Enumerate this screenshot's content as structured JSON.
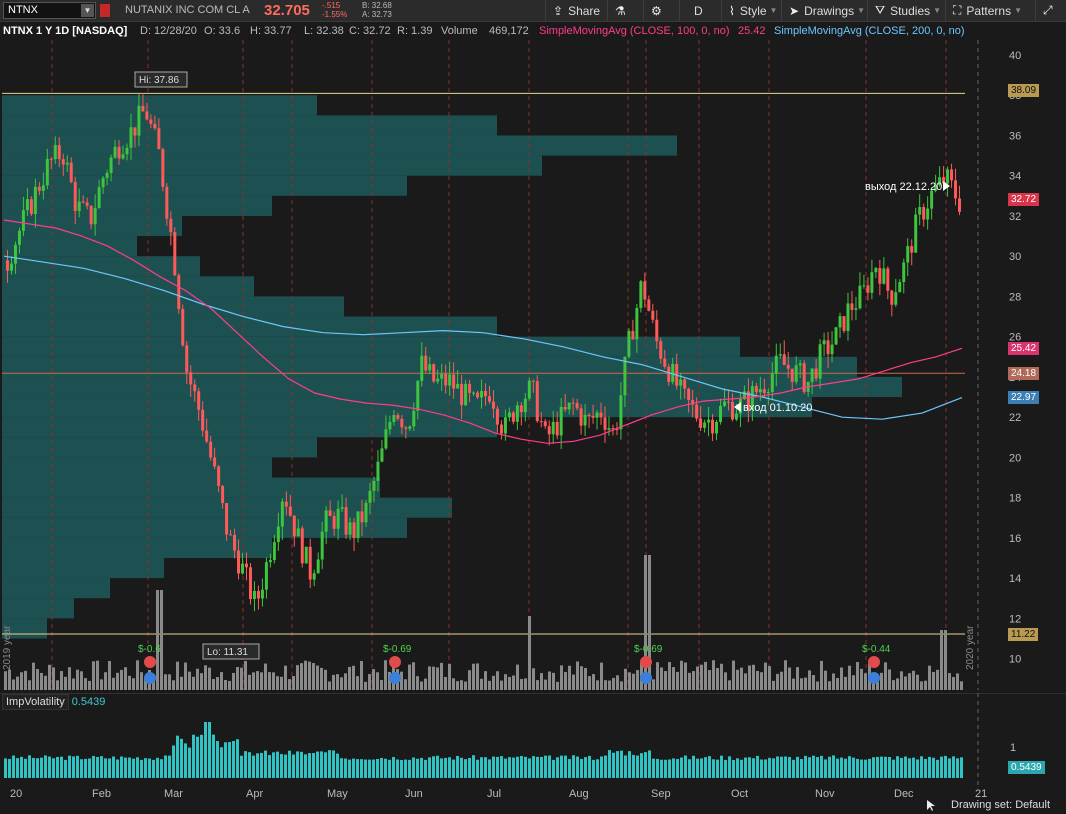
{
  "toolbar": {
    "symbol": "NTNX",
    "company": "NUTANIX INC COM CL A",
    "last": "32.705",
    "net_change": "-.515",
    "pct_change": "-1.55%",
    "bid": "B: 32.68",
    "ask": "A: 32.73",
    "share": "Share",
    "period": "D",
    "style": "Style",
    "drawings": "Drawings",
    "studies": "Studies",
    "patterns": "Patterns"
  },
  "header": {
    "title": "NTNX 1 Y 1D [NASDAQ]",
    "date": "D: 12/28/20",
    "open": "O: 33.6",
    "high": "H: 33.77",
    "low": "L: 32.38",
    "close": "C: 32.72",
    "range": "R: 1.39",
    "volume_label": "Volume",
    "volume": "469,172",
    "sma100": "SimpleMovingAvg (CLOSE, 100, 0, no)",
    "sma100_val": "25.42",
    "sma200": "SimpleMovingAvg (CLOSE, 200, 0, no)",
    "sma200_val": "22.97"
  },
  "annotations": {
    "hi": "Hi: 37.86",
    "lo": "Lo: 11.31",
    "entry": "вход 01.10.20",
    "exit": "выход 22.12.20",
    "earn1": "$-0.6",
    "earn2": "$-0.69",
    "earn3": "$-0.69",
    "earn4": "$-0.44",
    "year_2019": "2019 year",
    "year_2020": "2020 year"
  },
  "price_tags": {
    "hi_line": "38.09",
    "last": "32.72",
    "sma100": "25.42",
    "hline": "24.18",
    "sma200": "22.97",
    "lo_line": "11.22"
  },
  "iv": {
    "label": "ImpVolatility",
    "value": "0.5439",
    "axis_1": "1"
  },
  "y_axis_labels": [
    "40",
    "38",
    "36",
    "34",
    "32",
    "30",
    "28",
    "26",
    "24",
    "22",
    "20",
    "18",
    "16",
    "14",
    "12",
    "10"
  ],
  "x_axis_labels": [
    "20",
    "Feb",
    "Mar",
    "Apr",
    "May",
    "Jun",
    "Jul",
    "Aug",
    "Sep",
    "Oct",
    "Nov",
    "Dec",
    "21"
  ],
  "status": {
    "drawing_set": "Drawing set: Default"
  },
  "colors": {
    "up": "#3ec43e",
    "down": "#ff5a5a",
    "sma100": "#ff3d8b",
    "sma200": "#6ec6ff",
    "volume_profile": "#1f5b5a",
    "iv": "#2ec4c4",
    "volume": "#8a8a8a"
  },
  "chart_data": [
    {
      "type": "candlestick",
      "title": "NTNX 1 Y 1D [NASDAQ]",
      "ylim": [
        9.5,
        40.5
      ],
      "x": [
        "2020-01",
        "2020-02",
        "2020-03",
        "2020-04",
        "2020-05",
        "2020-06",
        "2020-07",
        "2020-08",
        "2020-09",
        "2020-10",
        "2020-11",
        "2020-12"
      ],
      "close_path": [
        29.8,
        31.5,
        33.1,
        34.6,
        35.2,
        32.5,
        31.8,
        34.1,
        35.5,
        36.2,
        37.3,
        35.0,
        30.4,
        24.3,
        22.1,
        19.2,
        16.1,
        14.5,
        12.6,
        15.3,
        18.4,
        16.1,
        14.2,
        16.7,
        17.1,
        16.2,
        17.4,
        19.8,
        22.6,
        21.5,
        24.6,
        23.7,
        23.8,
        23.1,
        22.5,
        23.4,
        21.3,
        22.8,
        23.4,
        20.9,
        21.8,
        22.6,
        21.7,
        22.3,
        21.1,
        25.5,
        28.7,
        25.8,
        24.3,
        22.9,
        22.1,
        21.8,
        22.6,
        22.5,
        23.1,
        23.8,
        24.7,
        24.3,
        23.7,
        25.1,
        25.9,
        27.4,
        28.1,
        29.7,
        28.0,
        29.5,
        31.8,
        33.1,
        33.9,
        32.72
      ],
      "sma100": [
        31.8,
        31.6,
        31.4,
        31.0,
        30.5,
        29.8,
        29.0,
        28.3,
        27.4,
        26.2,
        25.0,
        23.9,
        23.2,
        22.9,
        22.7,
        22.6,
        22.4,
        22.1,
        21.7,
        21.2,
        20.9,
        20.7,
        20.8,
        21.1,
        21.6,
        22.1,
        22.5,
        22.8,
        22.9,
        23.0,
        23.2,
        23.5,
        23.7,
        23.9,
        24.3,
        24.7,
        25.0,
        25.42
      ],
      "sma200": [
        30.0,
        29.7,
        29.4,
        28.9,
        28.3,
        27.6,
        27.0,
        26.5,
        26.2,
        26.1,
        26.2,
        26.3,
        26.2,
        25.9,
        25.5,
        25.0,
        24.6,
        24.0,
        23.4,
        23.0,
        22.5,
        22.0,
        21.9,
        22.2,
        22.97
      ],
      "horizontal_lines": [
        38.09,
        24.18,
        11.22
      ],
      "hi": 37.86,
      "lo": 11.31,
      "earnings": [
        -0.6,
        -0.69,
        -0.69,
        -0.44
      ]
    },
    {
      "type": "bar",
      "title": "ImpVolatility",
      "ylim": [
        0,
        1.6
      ],
      "last": 0.5439
    }
  ]
}
